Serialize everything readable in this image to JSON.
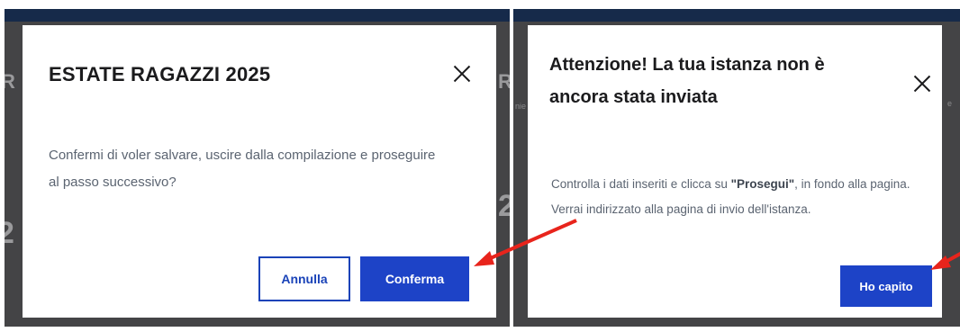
{
  "left_modal": {
    "title": "ESTATE RAGAZZI 2025",
    "message": "Confermi di voler salvare, uscire dalla compilazione e proseguire al passo successivo?",
    "cancel_label": "Annulla",
    "confirm_label": "Conferma"
  },
  "right_modal": {
    "title": "Attenzione! La tua istanza non è ancora stata inviata",
    "message_part1": "Controlla i dati inseriti e clicca su ",
    "message_bold": "\"Prosegui\"",
    "message_part2": ", in fondo alla pagina. Verrai indirizzato alla pagina di invio dell'istanza.",
    "ok_label": "Ho capito"
  },
  "colors": {
    "overlay": "#444446",
    "header": "#162a4a",
    "primary": "#1d43c7",
    "arrow": "#e8241c"
  },
  "icons": [
    "close-icon",
    "arrow-annotation"
  ]
}
